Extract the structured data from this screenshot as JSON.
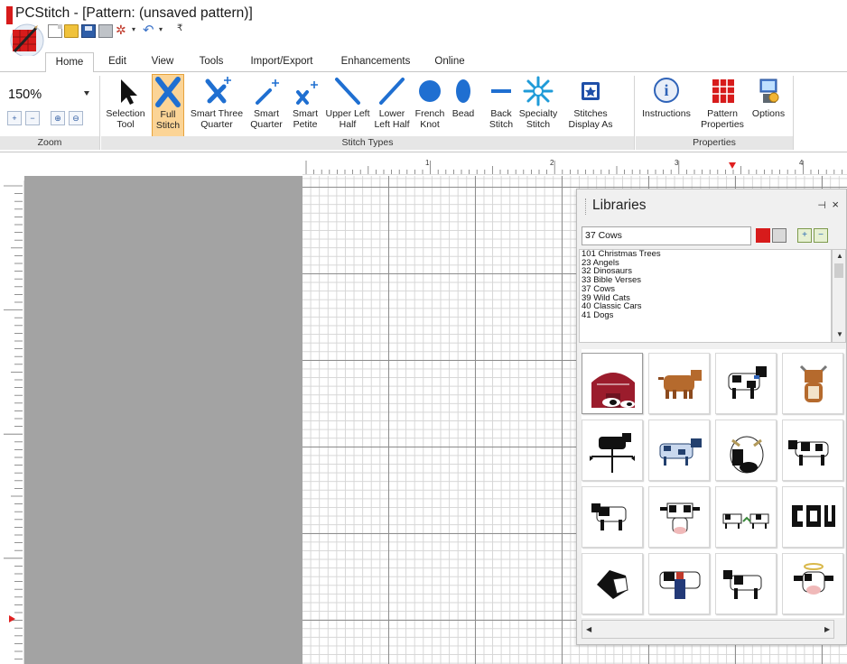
{
  "window": {
    "title": "PCStitch - [Pattern: (unsaved pattern)]"
  },
  "colors": {
    "accent_red": "#d71b1b",
    "pressed_bg": "#fbd496",
    "pressed_border": "#e6a23c",
    "icon_blue": "#1f6fd1",
    "workspace_gray": "#a3a3a3"
  },
  "tabs": [
    {
      "label": "Home",
      "active": true
    },
    {
      "label": "Edit",
      "active": false
    },
    {
      "label": "View",
      "active": false
    },
    {
      "label": "Tools",
      "active": false
    },
    {
      "label": "Import/Export",
      "active": false
    },
    {
      "label": "Enhancements",
      "active": false
    },
    {
      "label": "Online",
      "active": false
    }
  ],
  "ribbon": {
    "zoom": {
      "value": "150%",
      "group_label": "Zoom"
    },
    "stitch_types": {
      "group_label": "Stitch Types",
      "buttons": [
        {
          "label": "Selection Tool",
          "icon": "arrow-cursor-icon",
          "pressed": false
        },
        {
          "label": "Full Stitch",
          "icon": "full-stitch-x-icon",
          "pressed": true
        },
        {
          "label": "Smart Three Quarter",
          "icon": "smart-three-quarter-icon",
          "pressed": false
        },
        {
          "label": "Smart Quarter",
          "icon": "smart-quarter-icon",
          "pressed": false
        },
        {
          "label": "Smart Petite",
          "icon": "smart-petite-icon",
          "pressed": false
        },
        {
          "label": "Upper Left Half",
          "icon": "upper-left-half-icon",
          "pressed": false
        },
        {
          "label": "Lower Left Half",
          "icon": "lower-left-half-icon",
          "pressed": false
        },
        {
          "label": "French Knot",
          "icon": "french-knot-icon",
          "pressed": false
        },
        {
          "label": "Bead",
          "icon": "bead-icon",
          "pressed": false
        },
        {
          "label": "Back Stitch",
          "icon": "back-stitch-icon",
          "pressed": false
        },
        {
          "label": "Specialty Stitch",
          "icon": "specialty-stitch-icon",
          "pressed": false
        },
        {
          "label": "Stitches Display As",
          "icon": "stitches-display-icon",
          "pressed": false
        }
      ]
    },
    "properties": {
      "group_label": "Properties",
      "buttons": [
        {
          "label": "Instructions",
          "icon": "info-icon"
        },
        {
          "label": "Pattern Properties",
          "icon": "pattern-properties-icon"
        },
        {
          "label": "Options",
          "icon": "options-icon"
        }
      ]
    }
  },
  "ruler": {
    "marks": [
      "1",
      "2",
      "3",
      "4"
    ]
  },
  "libraries": {
    "title": "Libraries",
    "selected": "37 Cows",
    "items": [
      "101 Christmas Trees",
      "23 Angels",
      "32 Dinosaurs",
      "33 Bible Verses",
      "37 Cows",
      "39 Wild Cats",
      "40 Classic Cars",
      "41 Dogs"
    ],
    "thumbnails": [
      {
        "name": "barn-cows",
        "icon": "barn-icon"
      },
      {
        "name": "brown-cow",
        "icon": "cow-icon"
      },
      {
        "name": "holstein-cow",
        "icon": "cow-icon"
      },
      {
        "name": "brown-cow-front",
        "icon": "cow-icon"
      },
      {
        "name": "cow-weathervane",
        "icon": "weathervane-icon"
      },
      {
        "name": "blue-cow",
        "icon": "cow-icon"
      },
      {
        "name": "cow-face",
        "icon": "cow-icon"
      },
      {
        "name": "holstein-standing",
        "icon": "cow-icon"
      },
      {
        "name": "black-white-cow",
        "icon": "cow-icon"
      },
      {
        "name": "cow-head-front",
        "icon": "cow-icon"
      },
      {
        "name": "two-cows",
        "icon": "cow-icon"
      },
      {
        "name": "cow-lettering",
        "icon": "cow-icon"
      },
      {
        "name": "cow-head-side",
        "icon": "cow-icon"
      },
      {
        "name": "cow-overalls",
        "icon": "cow-icon"
      },
      {
        "name": "cow-walking",
        "icon": "cow-icon"
      },
      {
        "name": "angel-cow",
        "icon": "cow-icon"
      }
    ]
  }
}
